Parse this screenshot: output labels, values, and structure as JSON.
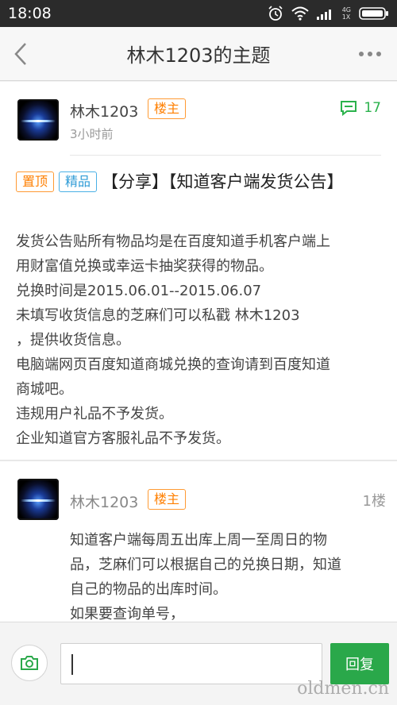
{
  "status_bar": {
    "time": "18:08",
    "network_top": "4G",
    "network_bottom": "1X"
  },
  "header": {
    "title": "林木1203的主题"
  },
  "post": {
    "author": "林木1203",
    "author_badge": "楼主",
    "time_ago": "3小时前",
    "comment_count": "17",
    "tag_pinned": "置顶",
    "tag_featured": "精品",
    "title": "【分享】【知道客户端发货公告】",
    "body_lines": [
      "发货公告贴所有物品均是在百度知道手机客户端上",
      "用财富值兑换或幸运卡抽奖获得的物品。",
      "兑换时间是2015.06.01--2015.06.07",
      "未填写收货信息的芝麻们可以私戳 林木1203",
      "，提供收货信息。",
      "电脑端网页百度知道商城兑换的查询请到百度知道",
      "商城吧。",
      "违规用户礼品不予发货。",
      "企业知道官方客服礼品不予发货。"
    ]
  },
  "reply": {
    "author": "林木1203",
    "author_badge": "楼主",
    "floor": "1楼",
    "body_lines": [
      "知道客户端每周五出库上周一至周日的物",
      "品，芝麻们可以根据自己的兑换日期，知道",
      "自己的物品的出库时间。",
      "如果要查询单号，"
    ]
  },
  "bottom_bar": {
    "input_value": "",
    "send_label": "回复"
  },
  "watermark": "oldmen.cn",
  "colors": {
    "accent_green": "#2aa84a",
    "badge_orange": "#ff7f00",
    "badge_blue": "#2e9bd6"
  }
}
